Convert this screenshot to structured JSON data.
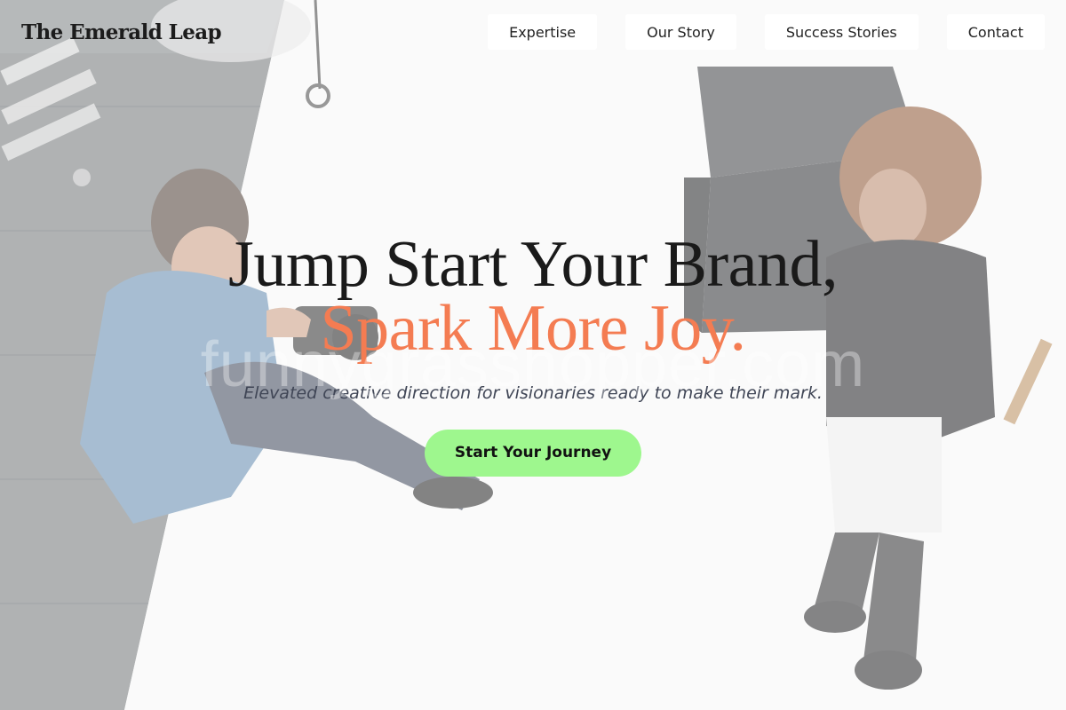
{
  "header": {
    "logo": "The Emerald Leap",
    "nav": [
      {
        "label": "Expertise"
      },
      {
        "label": "Our Story"
      },
      {
        "label": "Success Stories"
      },
      {
        "label": "Contact"
      }
    ]
  },
  "hero": {
    "headline_line1": "Jump Start Your Brand,",
    "headline_line2": "Spark More Joy.",
    "watermark": "funnygrasshopper.com",
    "subtitle": "Elevated creative direction for visionaries ready to make their mark.",
    "cta_label": "Start Your Journey"
  },
  "colors": {
    "accent_orange": "#f47c52",
    "cta_green": "#9ef78e",
    "heading_dark": "#1a1a1a",
    "nav_bg": "#ffffff"
  },
  "background": {
    "description_icon": "photo-background-icon"
  }
}
